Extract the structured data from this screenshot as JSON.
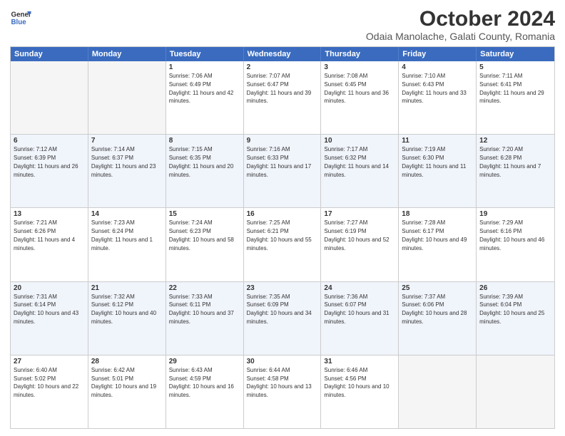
{
  "header": {
    "logo_line1": "General",
    "logo_line2": "Blue",
    "month_title": "October 2024",
    "subtitle": "Odaia Manolache, Galati County, Romania"
  },
  "days_of_week": [
    "Sunday",
    "Monday",
    "Tuesday",
    "Wednesday",
    "Thursday",
    "Friday",
    "Saturday"
  ],
  "weeks": [
    {
      "cells": [
        {
          "day": "",
          "text": ""
        },
        {
          "day": "",
          "text": ""
        },
        {
          "day": "1",
          "text": "Sunrise: 7:06 AM\nSunset: 6:49 PM\nDaylight: 11 hours and 42 minutes."
        },
        {
          "day": "2",
          "text": "Sunrise: 7:07 AM\nSunset: 6:47 PM\nDaylight: 11 hours and 39 minutes."
        },
        {
          "day": "3",
          "text": "Sunrise: 7:08 AM\nSunset: 6:45 PM\nDaylight: 11 hours and 36 minutes."
        },
        {
          "day": "4",
          "text": "Sunrise: 7:10 AM\nSunset: 6:43 PM\nDaylight: 11 hours and 33 minutes."
        },
        {
          "day": "5",
          "text": "Sunrise: 7:11 AM\nSunset: 6:41 PM\nDaylight: 11 hours and 29 minutes."
        }
      ]
    },
    {
      "cells": [
        {
          "day": "6",
          "text": "Sunrise: 7:12 AM\nSunset: 6:39 PM\nDaylight: 11 hours and 26 minutes."
        },
        {
          "day": "7",
          "text": "Sunrise: 7:14 AM\nSunset: 6:37 PM\nDaylight: 11 hours and 23 minutes."
        },
        {
          "day": "8",
          "text": "Sunrise: 7:15 AM\nSunset: 6:35 PM\nDaylight: 11 hours and 20 minutes."
        },
        {
          "day": "9",
          "text": "Sunrise: 7:16 AM\nSunset: 6:33 PM\nDaylight: 11 hours and 17 minutes."
        },
        {
          "day": "10",
          "text": "Sunrise: 7:17 AM\nSunset: 6:32 PM\nDaylight: 11 hours and 14 minutes."
        },
        {
          "day": "11",
          "text": "Sunrise: 7:19 AM\nSunset: 6:30 PM\nDaylight: 11 hours and 11 minutes."
        },
        {
          "day": "12",
          "text": "Sunrise: 7:20 AM\nSunset: 6:28 PM\nDaylight: 11 hours and 7 minutes."
        }
      ]
    },
    {
      "cells": [
        {
          "day": "13",
          "text": "Sunrise: 7:21 AM\nSunset: 6:26 PM\nDaylight: 11 hours and 4 minutes."
        },
        {
          "day": "14",
          "text": "Sunrise: 7:23 AM\nSunset: 6:24 PM\nDaylight: 11 hours and 1 minute."
        },
        {
          "day": "15",
          "text": "Sunrise: 7:24 AM\nSunset: 6:23 PM\nDaylight: 10 hours and 58 minutes."
        },
        {
          "day": "16",
          "text": "Sunrise: 7:25 AM\nSunset: 6:21 PM\nDaylight: 10 hours and 55 minutes."
        },
        {
          "day": "17",
          "text": "Sunrise: 7:27 AM\nSunset: 6:19 PM\nDaylight: 10 hours and 52 minutes."
        },
        {
          "day": "18",
          "text": "Sunrise: 7:28 AM\nSunset: 6:17 PM\nDaylight: 10 hours and 49 minutes."
        },
        {
          "day": "19",
          "text": "Sunrise: 7:29 AM\nSunset: 6:16 PM\nDaylight: 10 hours and 46 minutes."
        }
      ]
    },
    {
      "cells": [
        {
          "day": "20",
          "text": "Sunrise: 7:31 AM\nSunset: 6:14 PM\nDaylight: 10 hours and 43 minutes."
        },
        {
          "day": "21",
          "text": "Sunrise: 7:32 AM\nSunset: 6:12 PM\nDaylight: 10 hours and 40 minutes."
        },
        {
          "day": "22",
          "text": "Sunrise: 7:33 AM\nSunset: 6:11 PM\nDaylight: 10 hours and 37 minutes."
        },
        {
          "day": "23",
          "text": "Sunrise: 7:35 AM\nSunset: 6:09 PM\nDaylight: 10 hours and 34 minutes."
        },
        {
          "day": "24",
          "text": "Sunrise: 7:36 AM\nSunset: 6:07 PM\nDaylight: 10 hours and 31 minutes."
        },
        {
          "day": "25",
          "text": "Sunrise: 7:37 AM\nSunset: 6:06 PM\nDaylight: 10 hours and 28 minutes."
        },
        {
          "day": "26",
          "text": "Sunrise: 7:39 AM\nSunset: 6:04 PM\nDaylight: 10 hours and 25 minutes."
        }
      ]
    },
    {
      "cells": [
        {
          "day": "27",
          "text": "Sunrise: 6:40 AM\nSunset: 5:02 PM\nDaylight: 10 hours and 22 minutes."
        },
        {
          "day": "28",
          "text": "Sunrise: 6:42 AM\nSunset: 5:01 PM\nDaylight: 10 hours and 19 minutes."
        },
        {
          "day": "29",
          "text": "Sunrise: 6:43 AM\nSunset: 4:59 PM\nDaylight: 10 hours and 16 minutes."
        },
        {
          "day": "30",
          "text": "Sunrise: 6:44 AM\nSunset: 4:58 PM\nDaylight: 10 hours and 13 minutes."
        },
        {
          "day": "31",
          "text": "Sunrise: 6:46 AM\nSunset: 4:56 PM\nDaylight: 10 hours and 10 minutes."
        },
        {
          "day": "",
          "text": ""
        },
        {
          "day": "",
          "text": ""
        }
      ]
    }
  ]
}
